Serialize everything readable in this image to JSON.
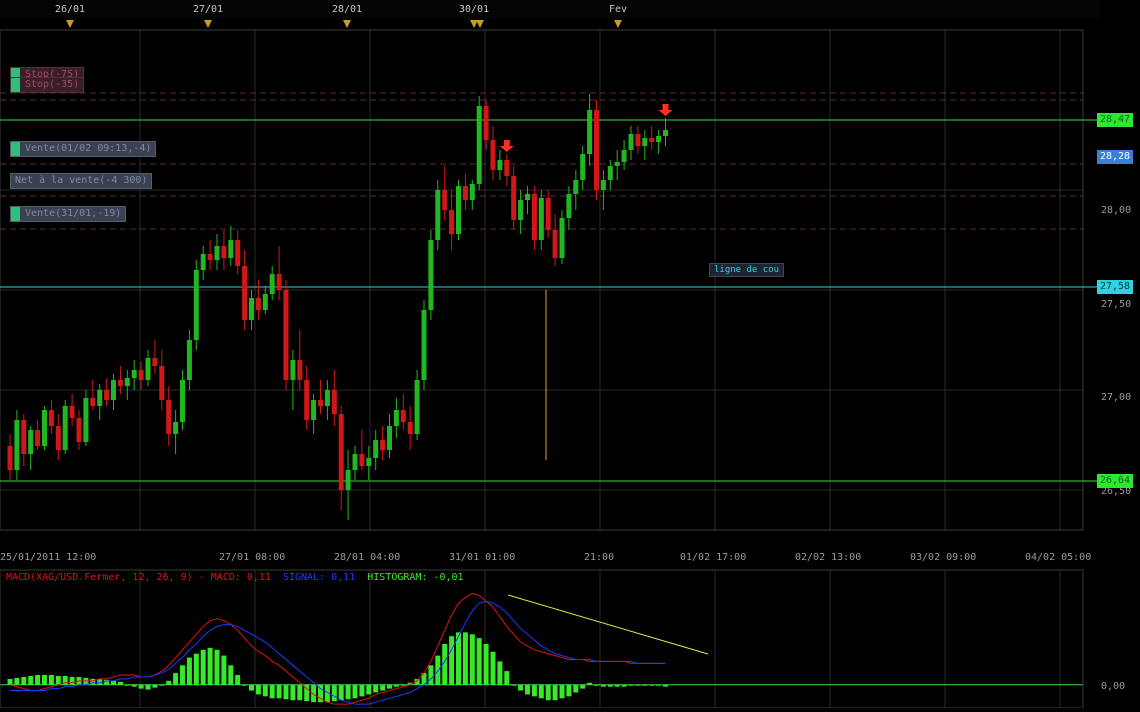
{
  "date_marks": [
    "26/01",
    "27/01",
    "28/01",
    "30/01",
    "Fev"
  ],
  "x_axis_labels": [
    "25/01/2011 12:00",
    "27/01 08:00",
    "28/01 04:00",
    "31/01 01:00",
    "21:00",
    "01/02 17:00",
    "02/02 13:00",
    "03/02 09:00",
    "04/02 05:00"
  ],
  "price_badges": {
    "upper_green": "28,47",
    "current": "28,28",
    "cyan_line": "27,58",
    "lower_green": "26,64"
  },
  "order_tags": {
    "stop1": "Stop(-75)",
    "stop2": "Stop(-35)",
    "vente1": "Vente(01/02 09:13,-4)",
    "net": "Net à la vente(-4 300)",
    "vente2": "Vente(31/01,-19)"
  },
  "line_label": "ligne de cou",
  "macd_legend": {
    "title": "MACD(XAG/USD.Fermer, 12, 26, 9)  -",
    "macd": "MACD: 0,11",
    "signal": "SIGNAL: 0,11",
    "histogram": "HISTOGRAM: -0,01"
  },
  "colors": {
    "up": "#22b722",
    "down": "#d01818",
    "grid": "#2a2a2a",
    "support_line": "#3ddc3d",
    "neck_line": "#2fd3e0",
    "macd_line": "#e01010",
    "signal_line": "#1a3cff",
    "histogram": "#38e82a",
    "trend_line": "#e8e84a"
  },
  "chart_data": {
    "type": "candlestick",
    "symbol": "XAG/USD",
    "y_ticks": [
      "28,00",
      "27,50",
      "27,00",
      "26,50"
    ],
    "ylim": [
      26.3,
      28.8
    ],
    "horizontal_levels": {
      "upper": 28.47,
      "current": 28.28,
      "neckline": 27.58,
      "lower": 26.64
    },
    "candles": [
      [
        26.72,
        26.78,
        26.55,
        26.6
      ],
      [
        26.6,
        26.9,
        26.55,
        26.85
      ],
      [
        26.85,
        26.88,
        26.62,
        26.68
      ],
      [
        26.68,
        26.82,
        26.6,
        26.8
      ],
      [
        26.8,
        26.85,
        26.7,
        26.72
      ],
      [
        26.72,
        26.92,
        26.7,
        26.9
      ],
      [
        26.9,
        26.95,
        26.78,
        26.82
      ],
      [
        26.82,
        26.88,
        26.65,
        26.7
      ],
      [
        26.7,
        26.95,
        26.68,
        26.92
      ],
      [
        26.92,
        26.98,
        26.82,
        26.86
      ],
      [
        26.86,
        26.9,
        26.7,
        26.74
      ],
      [
        26.74,
        27.0,
        26.72,
        26.96
      ],
      [
        26.96,
        27.05,
        26.9,
        26.92
      ],
      [
        26.92,
        27.03,
        26.85,
        27.0
      ],
      [
        27.0,
        27.06,
        26.92,
        26.95
      ],
      [
        26.95,
        27.08,
        26.9,
        27.05
      ],
      [
        27.05,
        27.12,
        26.98,
        27.02
      ],
      [
        27.02,
        27.1,
        26.95,
        27.06
      ],
      [
        27.06,
        27.15,
        27.0,
        27.1
      ],
      [
        27.1,
        27.14,
        27.0,
        27.05
      ],
      [
        27.05,
        27.2,
        27.02,
        27.16
      ],
      [
        27.16,
        27.25,
        27.08,
        27.12
      ],
      [
        27.12,
        27.2,
        26.9,
        26.95
      ],
      [
        26.95,
        27.02,
        26.72,
        26.78
      ],
      [
        26.78,
        26.9,
        26.68,
        26.84
      ],
      [
        26.84,
        27.1,
        26.8,
        27.05
      ],
      [
        27.05,
        27.3,
        27.0,
        27.25
      ],
      [
        27.25,
        27.65,
        27.2,
        27.6
      ],
      [
        27.6,
        27.72,
        27.55,
        27.68
      ],
      [
        27.68,
        27.75,
        27.6,
        27.65
      ],
      [
        27.65,
        27.78,
        27.6,
        27.72
      ],
      [
        27.72,
        27.8,
        27.6,
        27.66
      ],
      [
        27.66,
        27.82,
        27.62,
        27.75
      ],
      [
        27.75,
        27.8,
        27.58,
        27.62
      ],
      [
        27.62,
        27.7,
        27.3,
        27.35
      ],
      [
        27.35,
        27.5,
        27.3,
        27.46
      ],
      [
        27.46,
        27.55,
        27.35,
        27.4
      ],
      [
        27.4,
        27.52,
        27.38,
        27.48
      ],
      [
        27.48,
        27.62,
        27.45,
        27.58
      ],
      [
        27.58,
        27.72,
        27.45,
        27.5
      ],
      [
        27.5,
        27.55,
        27.0,
        27.05
      ],
      [
        27.05,
        27.2,
        26.9,
        27.15
      ],
      [
        27.15,
        27.3,
        27.0,
        27.05
      ],
      [
        27.05,
        27.12,
        26.8,
        26.85
      ],
      [
        26.85,
        26.98,
        26.78,
        26.95
      ],
      [
        26.95,
        27.05,
        26.88,
        26.92
      ],
      [
        26.92,
        27.05,
        26.85,
        27.0
      ],
      [
        27.0,
        27.1,
        26.82,
        26.88
      ],
      [
        26.88,
        26.92,
        26.4,
        26.5
      ],
      [
        26.5,
        26.7,
        26.35,
        26.6
      ],
      [
        26.6,
        26.72,
        26.55,
        26.68
      ],
      [
        26.68,
        26.8,
        26.6,
        26.62
      ],
      [
        26.62,
        26.72,
        26.55,
        26.66
      ],
      [
        26.66,
        26.8,
        26.6,
        26.75
      ],
      [
        26.75,
        26.82,
        26.65,
        26.7
      ],
      [
        26.7,
        26.88,
        26.66,
        26.82
      ],
      [
        26.82,
        26.96,
        26.76,
        26.9
      ],
      [
        26.9,
        26.98,
        26.8,
        26.84
      ],
      [
        26.84,
        26.92,
        26.7,
        26.78
      ],
      [
        26.78,
        27.1,
        26.75,
        27.05
      ],
      [
        27.05,
        27.45,
        27.0,
        27.4
      ],
      [
        27.4,
        27.8,
        27.35,
        27.75
      ],
      [
        27.75,
        28.05,
        27.7,
        28.0
      ],
      [
        28.0,
        28.12,
        27.85,
        27.9
      ],
      [
        27.9,
        28.0,
        27.7,
        27.78
      ],
      [
        27.78,
        28.05,
        27.75,
        28.02
      ],
      [
        28.02,
        28.08,
        27.9,
        27.95
      ],
      [
        27.95,
        28.05,
        27.9,
        28.03
      ],
      [
        28.03,
        28.47,
        28.0,
        28.42
      ],
      [
        28.42,
        28.45,
        28.2,
        28.25
      ],
      [
        28.25,
        28.32,
        28.05,
        28.1
      ],
      [
        28.1,
        28.2,
        28.05,
        28.15
      ],
      [
        28.15,
        28.18,
        28.02,
        28.07
      ],
      [
        28.07,
        28.12,
        27.8,
        27.85
      ],
      [
        27.85,
        28.0,
        27.78,
        27.95
      ],
      [
        27.95,
        28.02,
        27.88,
        27.98
      ],
      [
        27.98,
        28.02,
        27.7,
        27.75
      ],
      [
        27.75,
        28.0,
        27.7,
        27.96
      ],
      [
        27.96,
        28.0,
        27.76,
        27.8
      ],
      [
        27.8,
        27.88,
        27.62,
        27.66
      ],
      [
        27.66,
        27.9,
        27.63,
        27.86
      ],
      [
        27.86,
        28.02,
        27.8,
        27.98
      ],
      [
        27.98,
        28.1,
        27.9,
        28.05
      ],
      [
        28.05,
        28.22,
        28.0,
        28.18
      ],
      [
        28.18,
        28.48,
        28.12,
        28.4
      ],
      [
        28.4,
        28.45,
        27.95,
        28.0
      ],
      [
        28.0,
        28.1,
        27.9,
        28.05
      ],
      [
        28.05,
        28.15,
        28.0,
        28.12
      ],
      [
        28.12,
        28.2,
        28.05,
        28.14
      ],
      [
        28.14,
        28.25,
        28.1,
        28.2
      ],
      [
        28.2,
        28.32,
        28.15,
        28.28
      ],
      [
        28.28,
        28.32,
        28.18,
        28.22
      ],
      [
        28.22,
        28.3,
        28.15,
        28.26
      ],
      [
        28.26,
        28.32,
        28.2,
        28.24
      ],
      [
        28.24,
        28.3,
        28.18,
        28.27
      ],
      [
        28.27,
        28.36,
        28.22,
        28.3
      ]
    ],
    "signals": [
      {
        "candle": 72,
        "type": "sell"
      },
      {
        "candle": 95,
        "type": "sell"
      }
    ],
    "macd": {
      "histogram": [
        0.03,
        0.035,
        0.04,
        0.045,
        0.05,
        0.05,
        0.05,
        0.045,
        0.045,
        0.04,
        0.04,
        0.035,
        0.03,
        0.03,
        0.025,
        0.02,
        0.015,
        0.0,
        -0.01,
        -0.02,
        -0.025,
        -0.015,
        0.0,
        0.02,
        0.06,
        0.1,
        0.14,
        0.16,
        0.18,
        0.19,
        0.18,
        0.15,
        0.1,
        0.05,
        0.0,
        -0.03,
        -0.05,
        -0.06,
        -0.07,
        -0.07,
        -0.075,
        -0.08,
        -0.08,
        -0.085,
        -0.09,
        -0.09,
        -0.09,
        -0.085,
        -0.08,
        -0.075,
        -0.07,
        -0.06,
        -0.05,
        -0.04,
        -0.03,
        -0.02,
        -0.01,
        0.0,
        0.01,
        0.03,
        0.06,
        0.1,
        0.15,
        0.21,
        0.25,
        0.27,
        0.27,
        0.26,
        0.24,
        0.21,
        0.17,
        0.12,
        0.07,
        0.0,
        -0.03,
        -0.05,
        -0.06,
        -0.07,
        -0.08,
        -0.08,
        -0.07,
        -0.06,
        -0.04,
        -0.02,
        0.01,
        0.0,
        -0.01,
        -0.01,
        -0.01,
        -0.01,
        0.0,
        0.0,
        0.0,
        0.0,
        0.0,
        -0.01
      ],
      "macd_line": [
        0.0,
        -0.01,
        -0.02,
        -0.03,
        -0.03,
        -0.02,
        -0.01,
        0.0,
        0.01,
        0.01,
        0.02,
        0.02,
        0.02,
        0.03,
        0.03,
        0.04,
        0.05,
        0.05,
        0.05,
        0.04,
        0.04,
        0.05,
        0.07,
        0.1,
        0.14,
        0.18,
        0.22,
        0.26,
        0.3,
        0.33,
        0.34,
        0.33,
        0.31,
        0.28,
        0.24,
        0.2,
        0.17,
        0.15,
        0.12,
        0.1,
        0.07,
        0.04,
        0.01,
        -0.02,
        -0.05,
        -0.07,
        -0.09,
        -0.1,
        -0.1,
        -0.1,
        -0.09,
        -0.08,
        -0.07,
        -0.05,
        -0.04,
        -0.03,
        -0.02,
        -0.01,
        0.0,
        0.02,
        0.06,
        0.12,
        0.2,
        0.28,
        0.36,
        0.42,
        0.45,
        0.47,
        0.46,
        0.43,
        0.4,
        0.35,
        0.3,
        0.26,
        0.22,
        0.2,
        0.18,
        0.17,
        0.16,
        0.15,
        0.14,
        0.13,
        0.13,
        0.13,
        0.12,
        0.12,
        0.12,
        0.12,
        0.12,
        0.12,
        0.11,
        0.11,
        0.11,
        0.11,
        0.11,
        0.11
      ],
      "signal_line": [
        -0.03,
        -0.03,
        -0.03,
        -0.03,
        -0.03,
        -0.03,
        -0.02,
        -0.02,
        -0.01,
        -0.01,
        0.0,
        0.0,
        0.01,
        0.01,
        0.02,
        0.02,
        0.03,
        0.03,
        0.04,
        0.04,
        0.04,
        0.05,
        0.06,
        0.08,
        0.11,
        0.14,
        0.18,
        0.21,
        0.25,
        0.28,
        0.3,
        0.31,
        0.31,
        0.3,
        0.28,
        0.26,
        0.24,
        0.22,
        0.19,
        0.16,
        0.13,
        0.1,
        0.07,
        0.04,
        0.01,
        -0.02,
        -0.04,
        -0.06,
        -0.08,
        -0.09,
        -0.1,
        -0.1,
        -0.1,
        -0.09,
        -0.08,
        -0.07,
        -0.06,
        -0.05,
        -0.04,
        -0.02,
        0.0,
        0.03,
        0.07,
        0.12,
        0.18,
        0.25,
        0.32,
        0.38,
        0.42,
        0.43,
        0.42,
        0.4,
        0.37,
        0.33,
        0.29,
        0.26,
        0.23,
        0.2,
        0.18,
        0.16,
        0.15,
        0.14,
        0.13,
        0.13,
        0.13,
        0.12,
        0.12,
        0.12,
        0.12,
        0.12,
        0.12,
        0.11,
        0.11,
        0.11,
        0.11,
        0.11
      ],
      "ylim": [
        -0.12,
        0.55
      ],
      "y_ticks": [
        "0,00"
      ]
    }
  }
}
